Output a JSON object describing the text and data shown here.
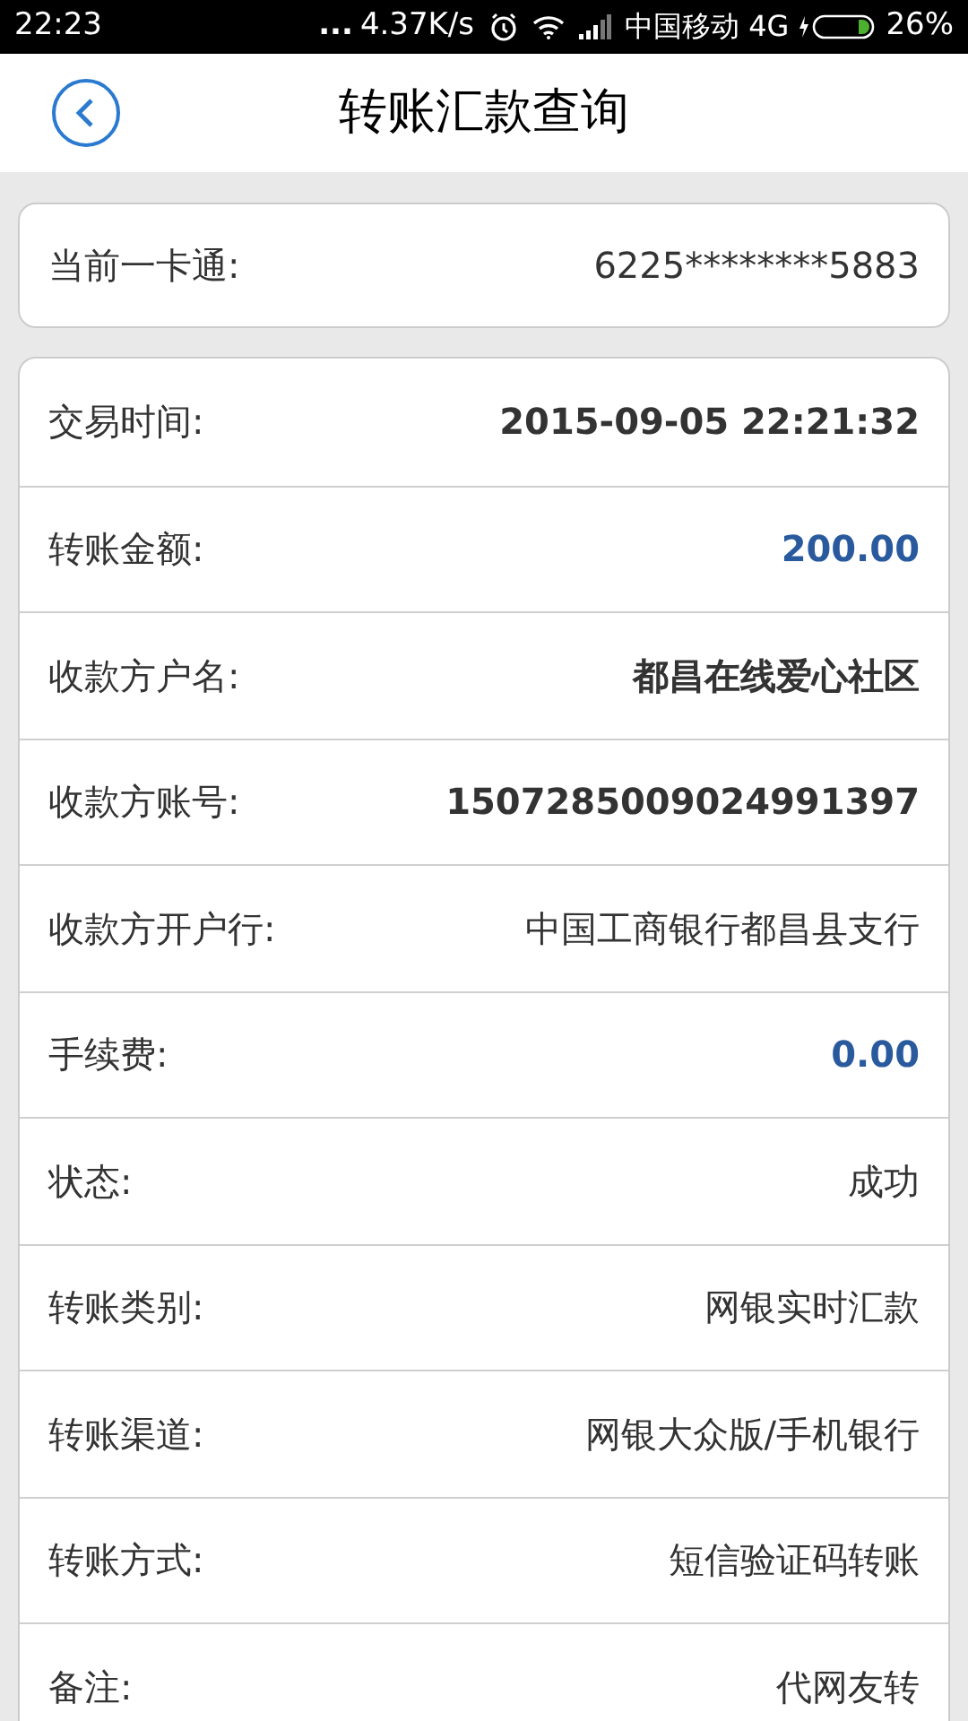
{
  "status_bar": {
    "time": "22:23",
    "dots": "...",
    "speed": "4.37K/s",
    "carrier": "中国移动 4G",
    "battery": "26%"
  },
  "header": {
    "title": "转账汇款查询"
  },
  "card": {
    "label": "当前一卡通:",
    "value": "6225********5883"
  },
  "details": [
    {
      "label": "交易时间:",
      "value": "2015-09-05 22:21:32",
      "kind": "bold"
    },
    {
      "label": "转账金额:",
      "value": "200.00",
      "kind": "amount"
    },
    {
      "label": "收款方户名:",
      "value": "都昌在线爱心社区",
      "kind": "bold"
    },
    {
      "label": "收款方账号:",
      "value": "1507285009024991397",
      "kind": "bold"
    },
    {
      "label": "收款方开户行:",
      "value": "中国工商银行都昌县支行",
      "kind": "plain"
    },
    {
      "label": "手续费:",
      "value": "0.00",
      "kind": "amount"
    },
    {
      "label": "状态:",
      "value": "成功",
      "kind": "plain"
    },
    {
      "label": "转账类别:",
      "value": "网银实时汇款",
      "kind": "plain"
    },
    {
      "label": "转账渠道:",
      "value": "网银大众版/手机银行",
      "kind": "plain"
    },
    {
      "label": "转账方式:",
      "value": "短信验证码转账",
      "kind": "plain"
    },
    {
      "label": "备注:",
      "value": "代网友转",
      "kind": "plain"
    }
  ]
}
